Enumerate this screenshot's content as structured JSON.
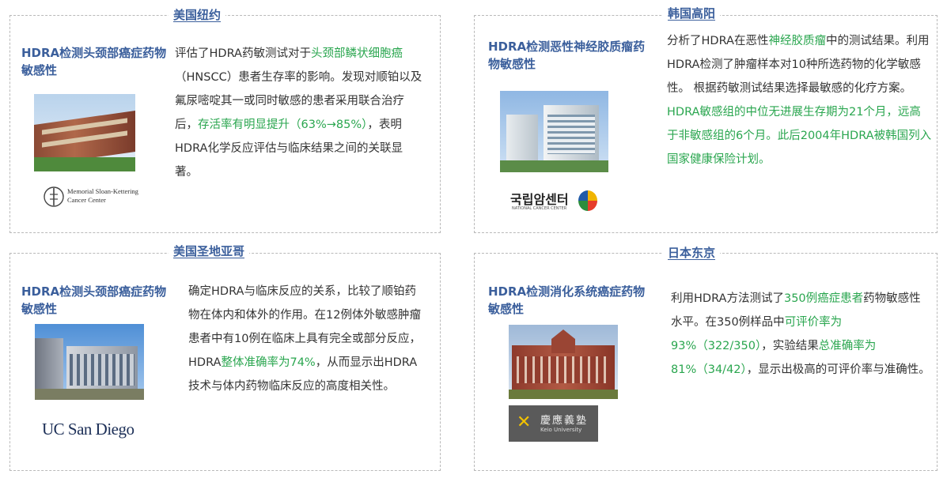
{
  "cards": [
    {
      "location": "美国纽约",
      "title": "HDRA检测头颈部癌症药物敏感性",
      "text": {
        "p1": "评估了HDRA药敏测试对于",
        "h1": "头颈部鳞状细胞癌",
        "p2": "（HNSCC）患者生存率的影响。发现对顺铂以及氟尿嘧啶其一或同时敏感的患者采用联合治疗后，",
        "h2": "存活率有明显提升（63%→85%）",
        "p3": "，表明HDRA化学反应评估与临床结果之间的关联显著。"
      },
      "logo": {
        "line1": "Memorial Sloan-Kettering",
        "line2": "Cancer Center"
      }
    },
    {
      "location": "韩国高阳",
      "title": "HDRA检测恶性神经胶质瘤药物敏感性",
      "text": {
        "p1": "分析了HDRA在恶性",
        "h1": "神经胶质瘤",
        "p2": "中的测试结果。利用HDRA检测了肿瘤样本对10种所选药物的化学敏感性。 根据药敏测试结果选择最敏感的化疗方案。",
        "h2": "HDRA敏感组的中位无进展生存期为21个月，远高于非敏感组的6个月。此后2004年HDRA被韩国列入国家健康保险计划。"
      },
      "logo": {
        "line1": "국립암센터",
        "line2": "NATIONAL CANCER CENTER"
      }
    },
    {
      "location": "美国圣地亚哥",
      "title": "HDRA检测头颈部癌症药物敏感性",
      "text": {
        "p1": "确定HDRA与临床反应的关系，比较了顺铂药物在体内和体外的作用。在12例体外敏感肿瘤患者中有10例在临床上具有完全或部分反应，HDRA",
        "h1": "整体准确率为74%",
        "p2": "，从而显示出HDRA技术与体内药物临床反应的高度相关性。"
      },
      "logo": {
        "line1": "UC San Diego"
      }
    },
    {
      "location": "日本东京",
      "title": "HDRA检测消化系统癌症药物敏感性",
      "text": {
        "p1": "利用HDRA方法测试了",
        "h1": "350例癌症患者",
        "p2": "药物敏感性水平。在350例样品中",
        "h2": "可评价率为93%（322/350）",
        "p3": "，实验结果",
        "h3": "总准确率为81%（34/42）",
        "p4": "，显示出极高的可评价率与准确性。"
      },
      "logo": {
        "line1": "慶應義塾",
        "line2": "Keio University"
      }
    }
  ],
  "colors": {
    "accent": "#3b5f9c",
    "highlight": "#2aa64f",
    "text": "#333333",
    "border": "#b9b9b9"
  }
}
